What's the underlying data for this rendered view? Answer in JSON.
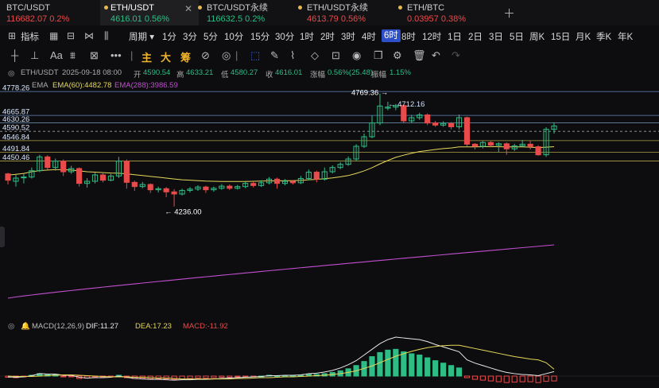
{
  "tabs": [
    {
      "name": "BTC/USDT",
      "price": "116682.07",
      "change": "0.2%",
      "dir": "neg",
      "active": false
    },
    {
      "name": "ETH/USDT",
      "price": "4616.01",
      "change": "0.56%",
      "dir": "pos",
      "active": true
    },
    {
      "name": "BTC/USDT永续",
      "price": "116632.5",
      "change": "0.2%",
      "dir": "pos",
      "active": false
    },
    {
      "name": "ETH/USDT永续",
      "price": "4613.79",
      "change": "0.56%",
      "dir": "neg",
      "active": false
    },
    {
      "name": "ETH/BTC",
      "price": "0.03957",
      "change": "0.38%",
      "dir": "neg",
      "active": false
    }
  ],
  "toolbar": {
    "indicator_label": "指标",
    "period_label": "周期",
    "timeframes": [
      "1分",
      "3分",
      "5分",
      "10分",
      "15分",
      "30分",
      "1时",
      "2时",
      "3时",
      "4时",
      "6时",
      "8时",
      "12时",
      "1日",
      "2日",
      "3日",
      "5日",
      "周K",
      "15日",
      "月K",
      "季K",
      "年K"
    ],
    "selected_timeframe": "6时"
  },
  "drawing_tools": {
    "text_icons": [
      "Aa"
    ],
    "gold_labels": [
      "主",
      "大",
      "筹"
    ]
  },
  "ohlc": {
    "symbol": "ETH/USDT",
    "time": "2025-09-18 08:00",
    "open_label": "开",
    "open": "4590.54",
    "high_label": "高",
    "high": "4633.21",
    "low_label": "低",
    "low": "4580.27",
    "close_label": "收",
    "close": "4616.01",
    "change_label": "涨幅",
    "change": "0.56%(25.48)",
    "amp_label": "振幅",
    "amp": "1.15%"
  },
  "ema": {
    "ema20": "EMA",
    "ema60": "EMA(60):4482.78",
    "ema288": "EMA(288):3986.59"
  },
  "price_levels": [
    "4778.26",
    "4665.87",
    "4630.26",
    "4590.52",
    "4546.84",
    "4491.84",
    "4450.46"
  ],
  "annotations": {
    "high": "4769.36",
    "high2": "4712.16",
    "low": "4236.00"
  },
  "macd": {
    "label": "MACD(12,26,9)",
    "dif": "DIF:11.27",
    "dea": "DEA:17.23",
    "macd": "MACD:-11.92"
  },
  "colors": {
    "up": "#2ebd85",
    "down": "#e84b4b",
    "ema60": "#e6d85a",
    "ema288": "#c24fd0",
    "accent": "#2d4fc7"
  },
  "chart_data": {
    "type": "candlestick",
    "price_range": [
      4190,
      4790
    ],
    "candles": [
      [
        4390,
        4360,
        4395,
        4340
      ],
      [
        4355,
        4370,
        4385,
        4330
      ],
      [
        4372,
        4375,
        4390,
        4345
      ],
      [
        4375,
        4405,
        4420,
        4368
      ],
      [
        4405,
        4470,
        4480,
        4398
      ],
      [
        4470,
        4420,
        4478,
        4410
      ],
      [
        4420,
        4450,
        4462,
        4405
      ],
      [
        4450,
        4400,
        4458,
        4380
      ],
      [
        4400,
        4415,
        4428,
        4390
      ],
      [
        4415,
        4345,
        4420,
        4330
      ],
      [
        4345,
        4355,
        4370,
        4325
      ],
      [
        4355,
        4385,
        4395,
        4345
      ],
      [
        4385,
        4360,
        4392,
        4350
      ],
      [
        4360,
        4380,
        4390,
        4355
      ],
      [
        4380,
        4450,
        4470,
        4370
      ],
      [
        4450,
        4350,
        4458,
        4320
      ],
      [
        4350,
        4330,
        4358,
        4310
      ],
      [
        4330,
        4340,
        4352,
        4322
      ],
      [
        4340,
        4315,
        4345,
        4300
      ],
      [
        4315,
        4320,
        4330,
        4302
      ],
      [
        4320,
        4305,
        4328,
        4280
      ],
      [
        4305,
        4295,
        4318,
        4236
      ],
      [
        4295,
        4312,
        4320,
        4288
      ],
      [
        4312,
        4318,
        4328,
        4302
      ],
      [
        4318,
        4328,
        4336,
        4310
      ],
      [
        4328,
        4315,
        4334,
        4300
      ],
      [
        4315,
        4322,
        4330,
        4306
      ],
      [
        4322,
        4332,
        4342,
        4315
      ],
      [
        4332,
        4322,
        4340,
        4314
      ],
      [
        4322,
        4330,
        4338,
        4316
      ],
      [
        4330,
        4345,
        4352,
        4322
      ],
      [
        4345,
        4335,
        4352,
        4326
      ],
      [
        4335,
        4348,
        4360,
        4328
      ],
      [
        4348,
        4365,
        4375,
        4340
      ],
      [
        4365,
        4345,
        4372,
        4320
      ],
      [
        4345,
        4355,
        4365,
        4336
      ],
      [
        4355,
        4348,
        4360,
        4340
      ],
      [
        4348,
        4368,
        4380,
        4342
      ],
      [
        4368,
        4398,
        4410,
        4360
      ],
      [
        4398,
        4365,
        4405,
        4350
      ],
      [
        4365,
        4400,
        4420,
        4358
      ],
      [
        4400,
        4420,
        4430,
        4392
      ],
      [
        4420,
        4435,
        4445,
        4412
      ],
      [
        4435,
        4460,
        4472,
        4428
      ],
      [
        4460,
        4520,
        4530,
        4452
      ],
      [
        4520,
        4565,
        4580,
        4512
      ],
      [
        4565,
        4630,
        4665,
        4558
      ],
      [
        4630,
        4710,
        4769,
        4620
      ],
      [
        4700,
        4705,
        4730,
        4690
      ],
      [
        4705,
        4712,
        4720,
        4690
      ],
      [
        4712,
        4640,
        4716,
        4630
      ],
      [
        4640,
        4655,
        4668,
        4630
      ],
      [
        4655,
        4668,
        4678,
        4645
      ],
      [
        4668,
        4630,
        4675,
        4620
      ],
      [
        4630,
        4620,
        4640,
        4612
      ],
      [
        4620,
        4628,
        4638,
        4612
      ],
      [
        4628,
        4612,
        4634,
        4600
      ],
      [
        4612,
        4655,
        4670,
        4600
      ],
      [
        4655,
        4530,
        4660,
        4520
      ],
      [
        4530,
        4520,
        4535,
        4505
      ],
      [
        4520,
        4538,
        4545,
        4510
      ],
      [
        4538,
        4525,
        4548,
        4515
      ],
      [
        4525,
        4532,
        4540,
        4492
      ],
      [
        4532,
        4508,
        4538,
        4480
      ],
      [
        4508,
        4522,
        4532,
        4498
      ],
      [
        4522,
        4530,
        4550,
        4515
      ],
      [
        4530,
        4518,
        4545,
        4505
      ],
      [
        4518,
        4480,
        4525,
        4476
      ],
      [
        4480,
        4600,
        4610,
        4470
      ],
      [
        4600,
        4616,
        4633,
        4580
      ]
    ],
    "ema60": [
      4384,
      4388,
      4392,
      4400,
      4405,
      4408,
      4410,
      4410,
      4408,
      4404,
      4400,
      4398,
      4396,
      4394,
      4393,
      4390,
      4386,
      4382,
      4378,
      4374,
      4370,
      4366,
      4362,
      4360,
      4358,
      4356,
      4355,
      4354,
      4354,
      4354,
      4354,
      4355,
      4356,
      4357,
      4357,
      4358,
      4358,
      4359,
      4362,
      4364,
      4367,
      4371,
      4376,
      4382,
      4392,
      4404,
      4419,
      4437,
      4453,
      4468,
      4478,
      4487,
      4495,
      4500,
      4505,
      4509,
      4512,
      4517,
      4517,
      4517,
      4518,
      4518,
      4518,
      4517,
      4517,
      4517,
      4516,
      4514,
      4516,
      4518
    ],
    "ema288_range": [
      3790,
      3986
    ],
    "macd_hist": [
      -3,
      -4,
      -2,
      2,
      6,
      4,
      3,
      -2,
      -1,
      -6,
      -5,
      -2,
      -3,
      -1,
      2,
      -4,
      -6,
      -6,
      -7,
      -7,
      -7,
      -8,
      -7,
      -6,
      -5,
      -5,
      -4,
      -3,
      -3,
      -2,
      -1,
      -1,
      0,
      2,
      1,
      1,
      1,
      2,
      5,
      4,
      6,
      9,
      13,
      18,
      26,
      36,
      48,
      58,
      64,
      66,
      60,
      55,
      52,
      45,
      38,
      32,
      26,
      20,
      -4,
      -8,
      -10,
      -12,
      -14,
      -16,
      -15,
      -14,
      -14,
      -16,
      -13,
      -12
    ],
    "dif": [
      -2,
      -3,
      -2,
      1,
      6,
      5,
      5,
      2,
      2,
      -3,
      -5,
      -4,
      -4,
      -3,
      0,
      -3,
      -6,
      -7,
      -8,
      -8,
      -9,
      -10,
      -9,
      -9,
      -8,
      -8,
      -7,
      -6,
      -5,
      -4,
      -3,
      -2,
      -1,
      1,
      1,
      2,
      2,
      3,
      6,
      7,
      10,
      14,
      20,
      28,
      38,
      52,
      66,
      80,
      90,
      96,
      94,
      92,
      90,
      85,
      78,
      72,
      66,
      60,
      40,
      32,
      26,
      20,
      14,
      9,
      6,
      4,
      3,
      1,
      6,
      11
    ],
    "dea": [
      0,
      -1,
      -1,
      -1,
      0,
      1,
      2,
      3,
      3,
      2,
      1,
      0,
      -1,
      -2,
      -2,
      -2,
      -3,
      -3,
      -4,
      -5,
      -5,
      -6,
      -7,
      -7,
      -7,
      -7,
      -7,
      -7,
      -7,
      -6,
      -6,
      -5,
      -4,
      -4,
      -3,
      -2,
      -2,
      -1,
      0,
      1,
      2,
      4,
      6,
      9,
      13,
      19,
      25,
      33,
      41,
      49,
      55,
      61,
      66,
      70,
      73,
      75,
      76,
      76,
      72,
      68,
      64,
      60,
      56,
      52,
      48,
      45,
      42,
      40,
      33,
      17
    ]
  }
}
